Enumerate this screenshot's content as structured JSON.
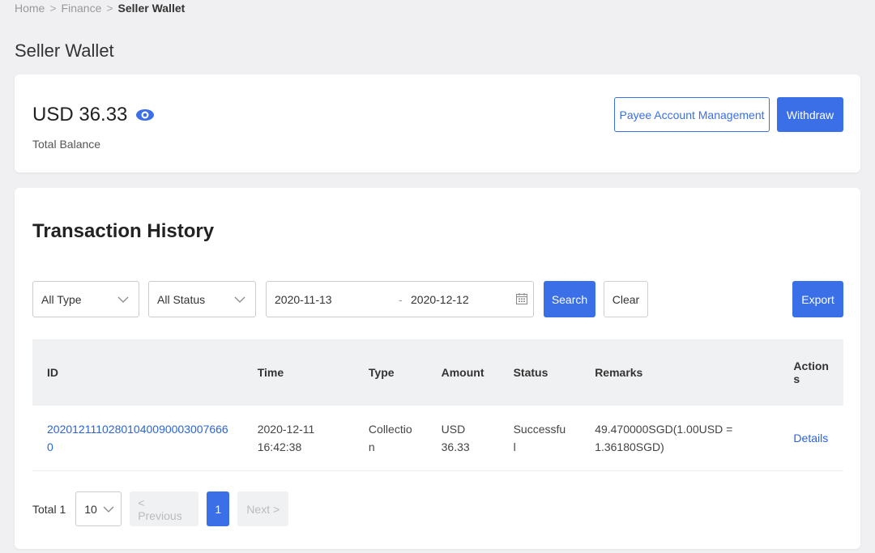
{
  "breadcrumb": {
    "home": "Home",
    "finance": "Finance",
    "current": "Seller Wallet",
    "separator": ">"
  },
  "page_title": "Seller Wallet",
  "balance": {
    "amount": "USD 36.33",
    "label": "Total Balance",
    "payee_button": "Payee Account Management",
    "withdraw_button": "Withdraw"
  },
  "history": {
    "title": "Transaction History",
    "filters": {
      "type": "All Type",
      "status": "All Status",
      "date_start": "2020-11-13",
      "date_separator": "-",
      "date_end": "2020-12-12",
      "search_button": "Search",
      "clear_button": "Clear",
      "export_button": "Export"
    },
    "columns": {
      "id": "ID",
      "time": "Time",
      "type": "Type",
      "amount": "Amount",
      "status": "Status",
      "remarks": "Remarks",
      "actions_l1": "Action",
      "actions_l2": "s"
    },
    "rows": [
      {
        "id": "20201211102801040090003007666​0",
        "time_l1": "2020-12-11",
        "time_l2": "16:42:38",
        "type_l1": "Collectio",
        "type_l2": "n",
        "amount_l1": "USD",
        "amount_l2": "36.33",
        "status_l1": "Successfu",
        "status_l2": "l",
        "remarks_l1": "49.470000SGD(1.00USD =",
        "remarks_l2": "1.36180SGD)",
        "action": "Details"
      }
    ]
  },
  "pagination": {
    "total": "Total 1",
    "page_size": "10",
    "previous": "< Previous",
    "current": "1",
    "next": "Next >"
  },
  "colors": {
    "accent": "#3a6fe8",
    "link": "#2b64d8",
    "background": "#f0f0f2"
  }
}
